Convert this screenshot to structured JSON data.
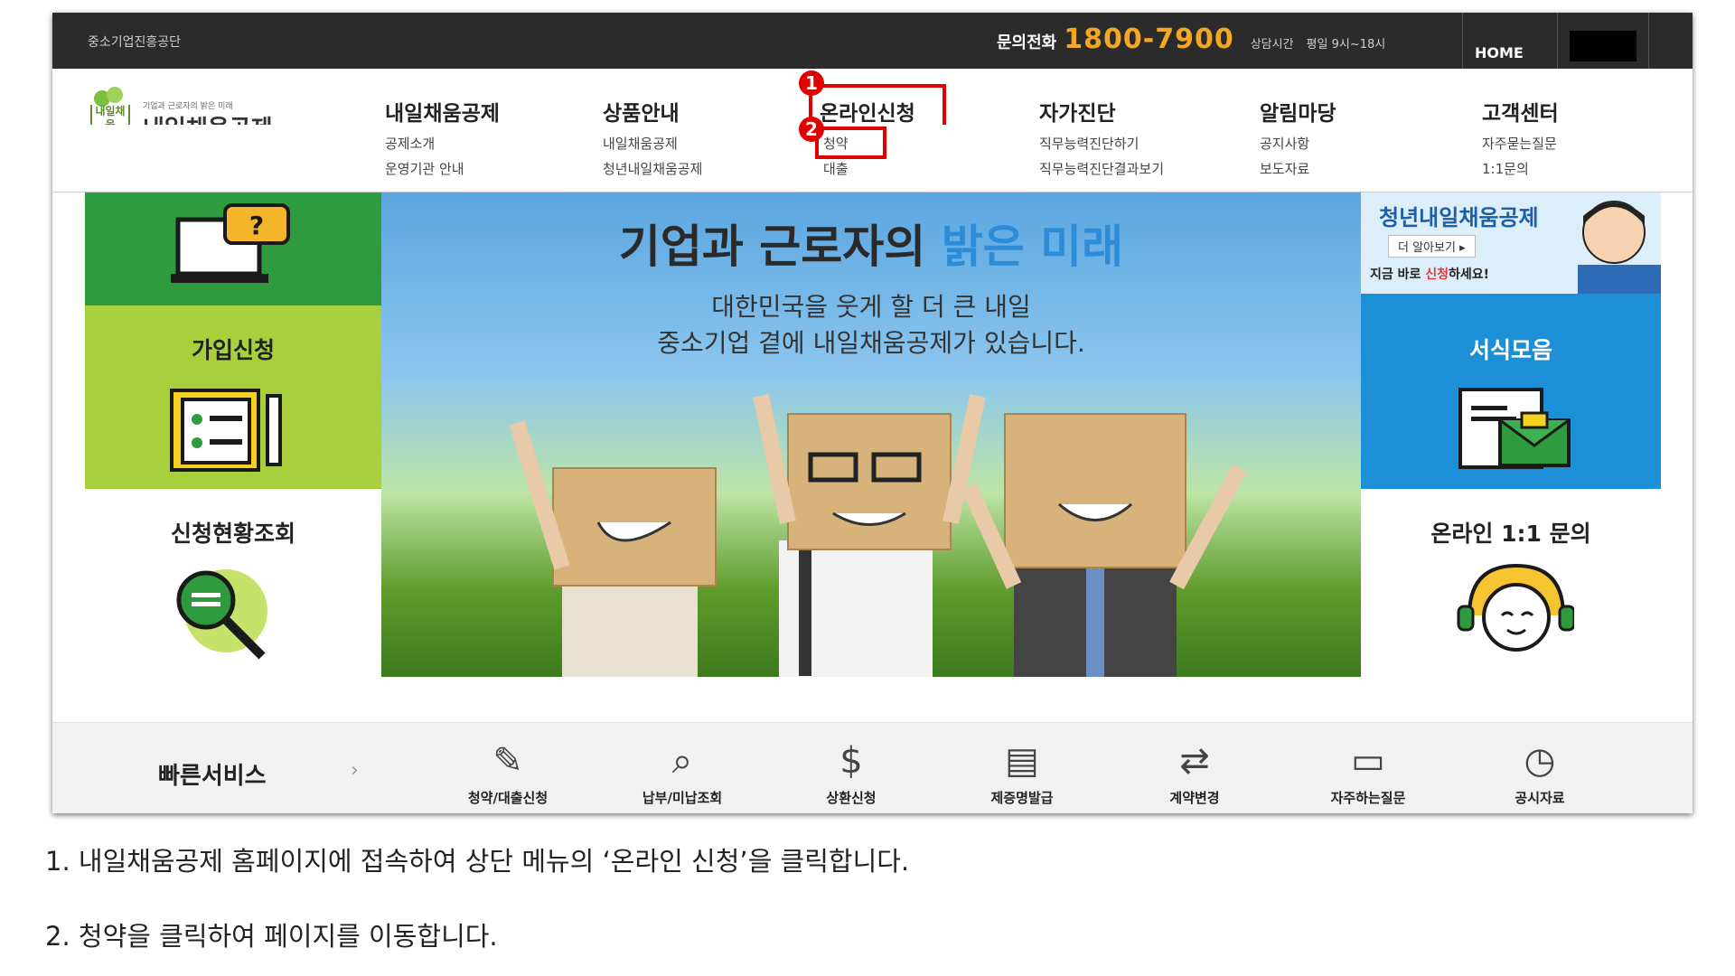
{
  "topbar": {
    "org": "중소기업진흥공단",
    "phone_label": "문의전화",
    "phone_number": "1800-7900",
    "hours_label": "상담시간",
    "hours": "평일 9시~18시",
    "home": "HOME"
  },
  "logo": {
    "tagline": "기업과 근로자의 밝은 미래",
    "name": "내일채움공제",
    "mark_text": "내일채움"
  },
  "nav": {
    "items": [
      {
        "label": "내일채움공제",
        "sub": [
          "공제소개",
          "운영기관 안내"
        ]
      },
      {
        "label": "상품안내",
        "sub": [
          "내일채움공제",
          "청년내일채움공제"
        ]
      },
      {
        "label": "온라인신청",
        "sub": [
          "청약",
          "대출"
        ]
      },
      {
        "label": "자가진단",
        "sub": [
          "직무능력진단하기",
          "직무능력진단결과보기"
        ]
      },
      {
        "label": "알림마당",
        "sub": [
          "공지사항",
          "보도자료"
        ]
      },
      {
        "label": "고객센터",
        "sub": [
          "자주묻는질문",
          "1:1문의"
        ]
      }
    ]
  },
  "annotations": {
    "badge1": "1",
    "badge2": "2"
  },
  "tiles": {
    "join": "가입신청",
    "status": "신청현황조회",
    "forms": "서식모음",
    "inquiry": "온라인 1:1 문의"
  },
  "promo": {
    "title": "청년내일채움공제",
    "more": "더 알아보기 ▸",
    "cta_prefix": "지금 바로 ",
    "cta_hl": "신청",
    "cta_suffix": "하세요!"
  },
  "hero": {
    "title_prefix": "기업과 근로자의 ",
    "title_highlight": "밝은 미래",
    "line1": "대한민국을 웃게 할 더 큰 내일",
    "line2": "중소기업 곁에 내일채움공제가 있습니다."
  },
  "quick": {
    "label": "빠른서비스",
    "arrow": "›",
    "items": [
      {
        "label": "청약/대출신청",
        "icon": "pen-icon"
      },
      {
        "label": "납부/미납조회",
        "icon": "search-doc-icon"
      },
      {
        "label": "상환신청",
        "icon": "money-bag-icon"
      },
      {
        "label": "제증명발급",
        "icon": "document-stamp-icon"
      },
      {
        "label": "계약변경",
        "icon": "exchange-icon"
      },
      {
        "label": "자주하는질문",
        "icon": "computer-chat-icon"
      },
      {
        "label": "공시자료",
        "icon": "clock-doc-icon"
      }
    ]
  },
  "captions": [
    "1. 내일채움공제 홈페이지에 접속하여 상단 메뉴의 ‘온라인 신청’을 클릭합니다.",
    "2. 청약을 클릭하여 페이지를 이동합니다."
  ],
  "colors": {
    "topbar": "#2b2b2b",
    "phone": "#f5a623",
    "highlight_box": "#e00000",
    "tile_green_dark": "#2e9b3f",
    "tile_green_light": "#a8cf3c",
    "tile_blue": "#1c8fd6"
  }
}
